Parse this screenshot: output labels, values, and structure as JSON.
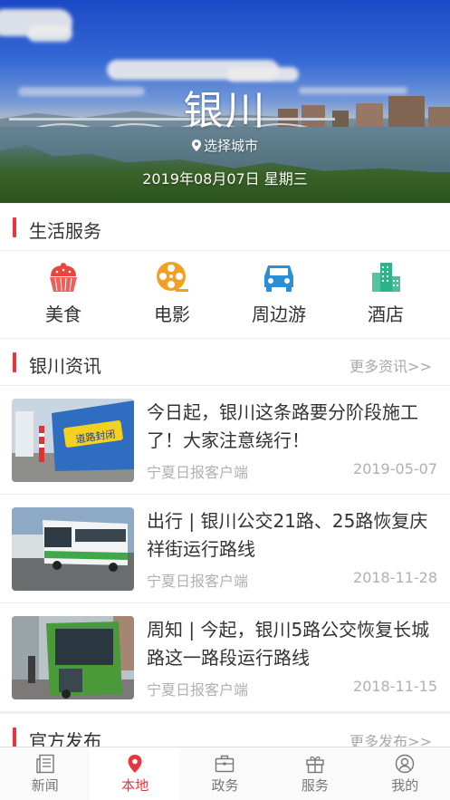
{
  "hero": {
    "city": "银川",
    "select_city": "选择城市",
    "date": "2019年08月07日  星期三"
  },
  "life_services": {
    "title": "生活服务",
    "items": [
      {
        "label": "美食",
        "icon": "cupcake-icon",
        "color": "#e8453c"
      },
      {
        "label": "电影",
        "icon": "film-reel-icon",
        "color": "#f2a024"
      },
      {
        "label": "周边游",
        "icon": "car-icon",
        "color": "#2b8fd6"
      },
      {
        "label": "酒店",
        "icon": "building-icon",
        "color": "#2bb38a"
      }
    ]
  },
  "news_section": {
    "title": "银川资讯",
    "more": "更多资讯>>",
    "items": [
      {
        "headline": "今日起，银川这条路要分阶段施工了！大家注意绕行！",
        "source": "宁夏日报客户端",
        "date": "2019-05-07",
        "thumb_text": "道路封闭"
      },
      {
        "headline": "出行 | 银川公交21路、25路恢复庆祥街运行路线",
        "source": "宁夏日报客户端",
        "date": "2018-11-28"
      },
      {
        "headline": "周知 | 今起，银川5路公交恢复长城路这一路段运行路线",
        "source": "宁夏日报客户端",
        "date": "2018-11-15"
      }
    ]
  },
  "official_section": {
    "title": "官方发布",
    "more": "更多发布>>"
  },
  "tabbar": {
    "items": [
      {
        "label": "新闻",
        "icon": "newspaper-icon"
      },
      {
        "label": "本地",
        "icon": "location-pin-icon",
        "active": true
      },
      {
        "label": "政务",
        "icon": "briefcase-icon"
      },
      {
        "label": "服务",
        "icon": "gift-icon"
      },
      {
        "label": "我的",
        "icon": "user-icon"
      }
    ]
  },
  "colors": {
    "accent": "#e8353f"
  }
}
